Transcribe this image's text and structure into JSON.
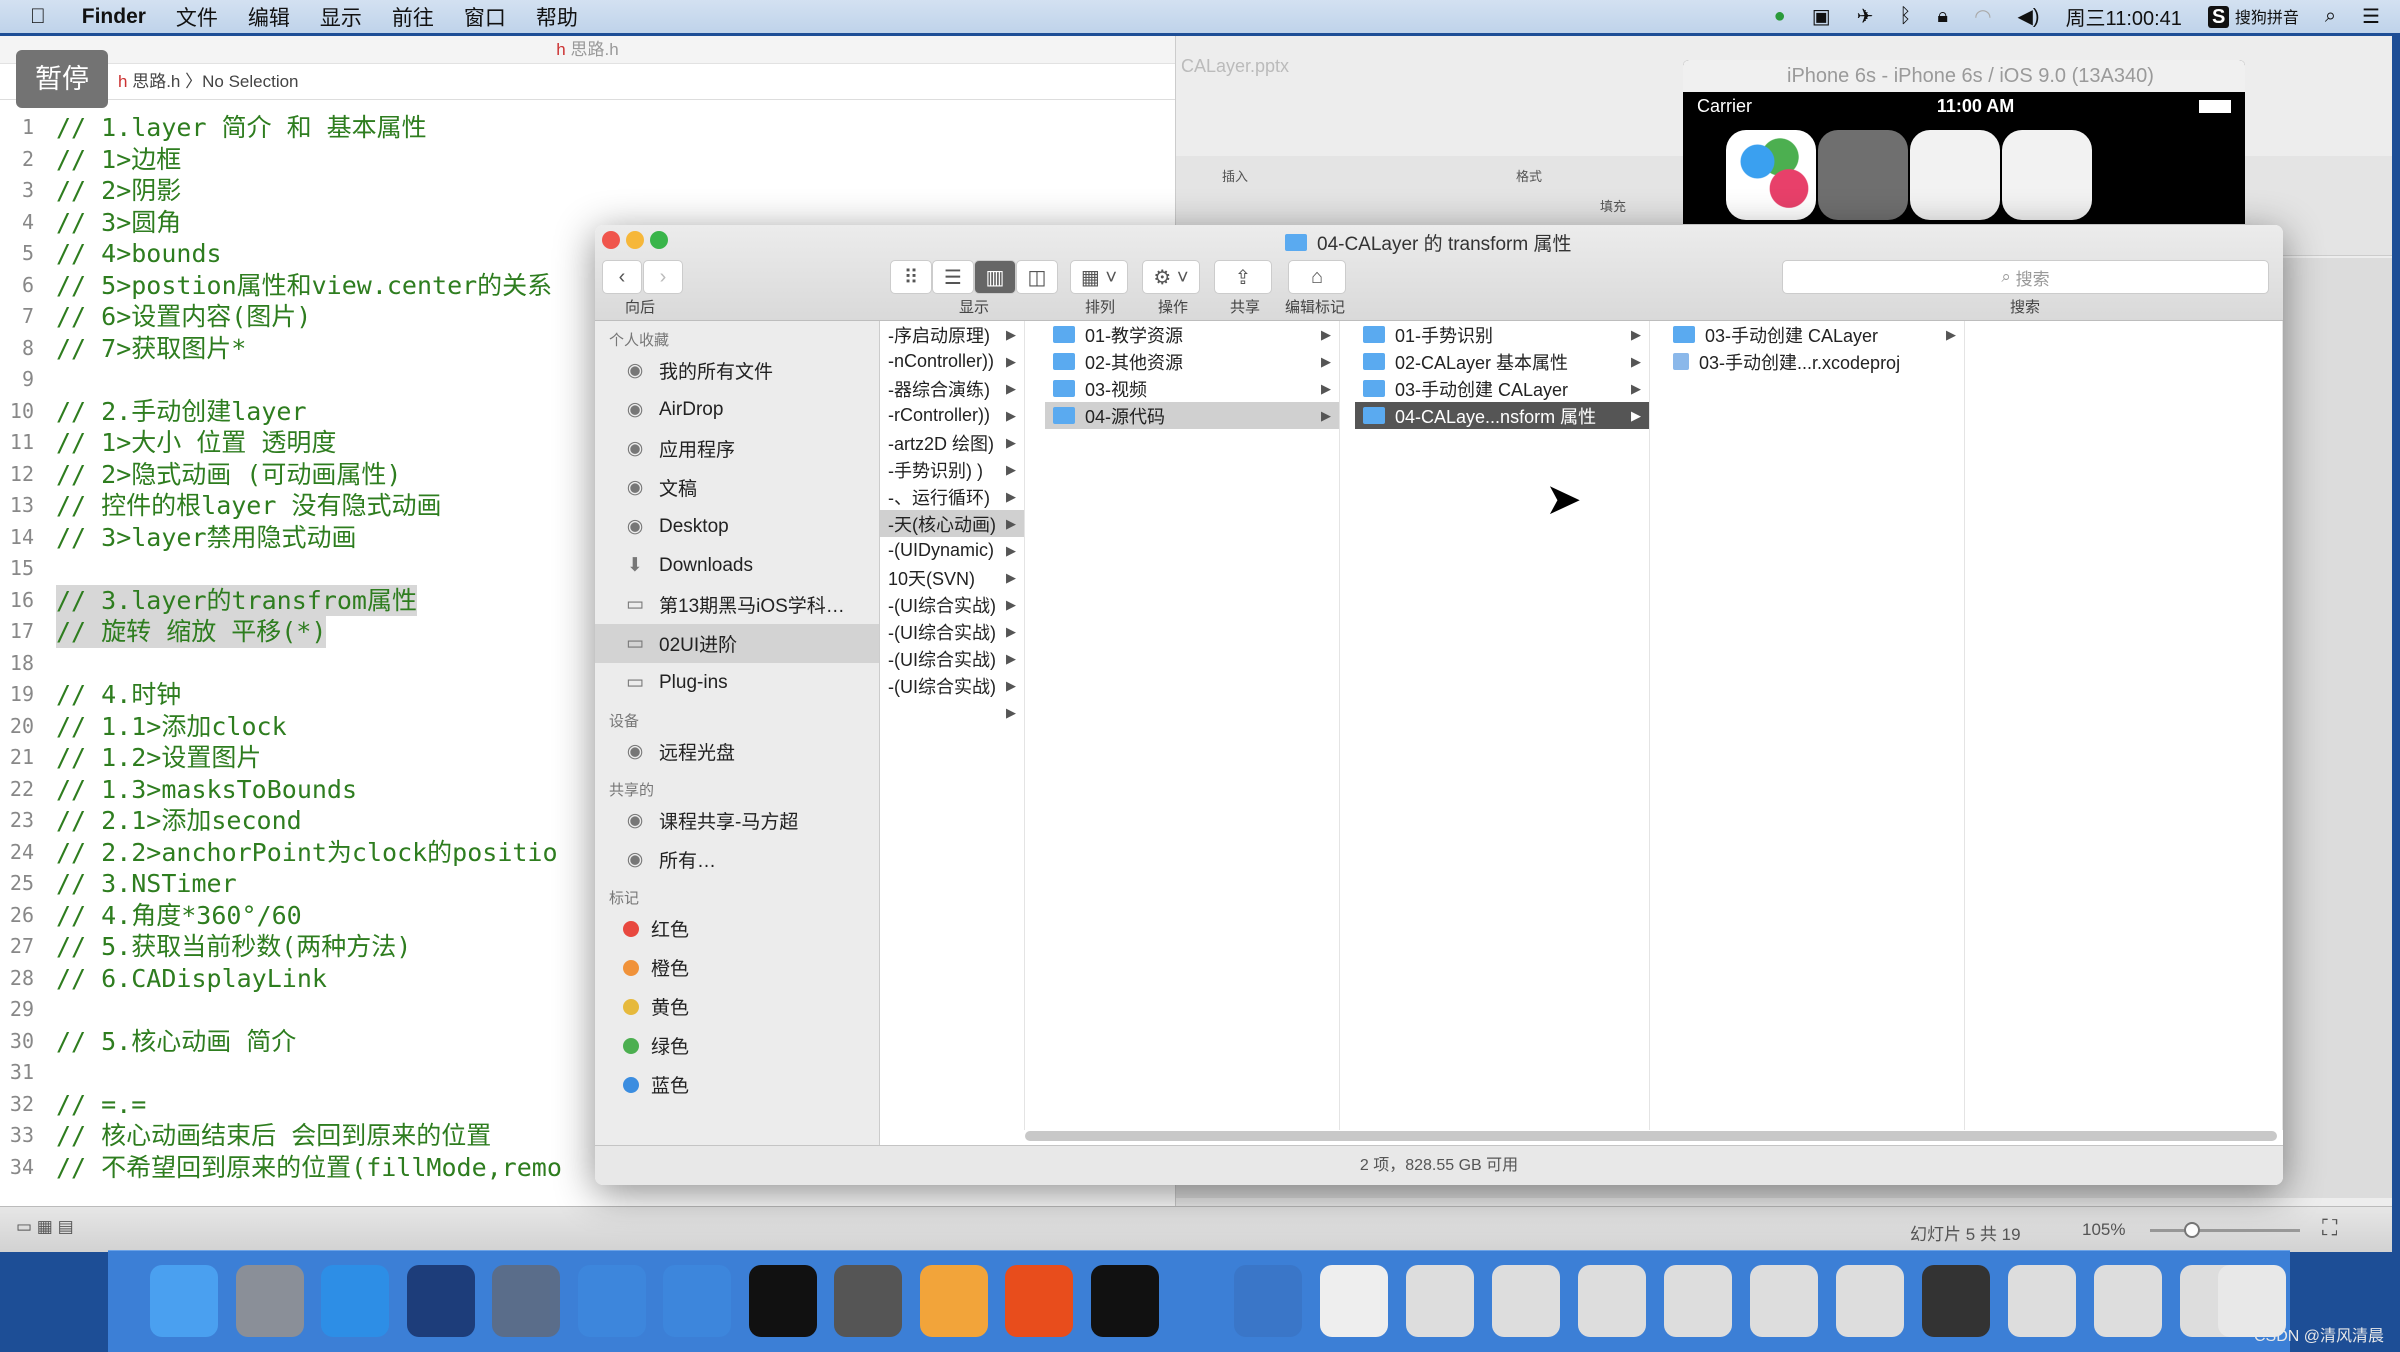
{
  "menubar": {
    "app": "Finder",
    "items": [
      "文件",
      "编辑",
      "显示",
      "前往",
      "窗口",
      "帮助"
    ],
    "clock": "周三11:00:41",
    "ime": "搜狗拼音"
  },
  "xcode": {
    "title": "思路.h",
    "path_file": "思路.h",
    "path_sel": "No Selection",
    "pause": "暂停",
    "lines": [
      "// 1.layer 简介 和 基本属性",
      "// 1>边框",
      "// 2>阴影",
      "// 3>圆角",
      "// 4>bounds",
      "// 5>postion属性和view.center的关系",
      "// 6>设置内容(图片)",
      "// 7>获取图片*",
      "",
      "// 2.手动创建layer",
      "// 1>大小 位置 透明度",
      "// 2>隐式动画 (可动画属性)",
      "// 控件的根layer 没有隐式动画",
      "// 3>layer禁用隐式动画",
      "",
      "// 3.layer的transfrom属性",
      "// 旋转 缩放 平移(*)",
      "",
      "// 4.时钟",
      "// 1.1>添加clock",
      "// 1.2>设置图片",
      "// 1.3>masksToBounds",
      "// 2.1>添加second",
      "// 2.2>anchorPoint为clock的positio",
      "// 3.NSTimer",
      "// 4.角度*360°/60",
      "// 5.获取当前秒数(两种方法)",
      "// 6.CADisplayLink",
      "",
      "// 5.核心动画 简介",
      "",
      "// =.=",
      "// 核心动画结束后 会回到原来的位置",
      "// 不希望回到原来的位置(fillMode,remo"
    ],
    "highlighted_lines": [
      16,
      17
    ]
  },
  "ppt": {
    "title_fragment": "CALayer.pptx",
    "ribbon": [
      "插入",
      "格式",
      "填充"
    ],
    "slide_info": "幻灯片 5 共 19",
    "zoom": "105%"
  },
  "simulator": {
    "title": "iPhone 6s - iPhone 6s / iOS 9.0 (13A340)",
    "carrier": "Carrier",
    "time": "11:00 AM"
  },
  "finder": {
    "title": "04-CALayer 的 transform 属性",
    "toolbar": {
      "back": "向后",
      "view": "显示",
      "arrange": "排列",
      "action": "操作",
      "share": "共享",
      "tags": "编辑标记",
      "search_placeholder": "搜索",
      "search_label": "搜索"
    },
    "sidebar": [
      {
        "header": "个人收藏",
        "items": [
          {
            "label": "我的所有文件",
            "icon": "all-files-icon"
          },
          {
            "label": "AirDrop",
            "icon": "airdrop-icon"
          },
          {
            "label": "应用程序",
            "icon": "applications-icon"
          },
          {
            "label": "文稿",
            "icon": "documents-icon"
          },
          {
            "label": "Desktop",
            "icon": "desktop-icon"
          },
          {
            "label": "Downloads",
            "icon": "downloads-icon"
          },
          {
            "label": "第13期黑马iOS学科…",
            "icon": "folder-icon"
          },
          {
            "label": "02UI进阶",
            "icon": "folder-icon",
            "selected": true
          },
          {
            "label": "Plug-ins",
            "icon": "folder-icon"
          }
        ]
      },
      {
        "header": "设备",
        "items": [
          {
            "label": "远程光盘",
            "icon": "disc-icon"
          }
        ]
      },
      {
        "header": "共享的",
        "items": [
          {
            "label": "课程共享-马方超",
            "icon": "computer-icon"
          },
          {
            "label": "所有…",
            "icon": "network-icon"
          }
        ]
      },
      {
        "header": "标记",
        "items": [
          {
            "label": "红色",
            "color": "#e8483f"
          },
          {
            "label": "橙色",
            "color": "#f0923a"
          },
          {
            "label": "黄色",
            "color": "#e6b93c"
          },
          {
            "label": "绿色",
            "color": "#4caf50"
          },
          {
            "label": "蓝色",
            "color": "#3b8de0"
          }
        ]
      }
    ],
    "columns": [
      {
        "items": [
          {
            "label": "-序启动原理)"
          },
          {
            "label": "-nController))"
          },
          {
            "label": "-器综合演练)"
          },
          {
            "label": "-rController))"
          },
          {
            "label": "-artz2D 绘图)"
          },
          {
            "label": "-手势识别) )"
          },
          {
            "label": "-、运行循环)"
          },
          {
            "label": "-天(核心动画)",
            "selected": true
          },
          {
            "label": "-(UIDynamic)"
          },
          {
            "label": "10天(SVN)"
          },
          {
            "label": "-(UI综合实战)"
          },
          {
            "label": "-(UI综合实战)"
          },
          {
            "label": "-(UI综合实战)"
          },
          {
            "label": "-(UI综合实战)"
          },
          {
            "label": ""
          }
        ]
      },
      {
        "items": [
          {
            "label": "01-教学资源",
            "folder": true
          },
          {
            "label": "02-其他资源",
            "folder": true
          },
          {
            "label": "03-视频",
            "folder": true
          },
          {
            "label": "04-源代码",
            "folder": true,
            "selected": true
          }
        ]
      },
      {
        "items": [
          {
            "label": "01-手势识别",
            "folder": true
          },
          {
            "label": "02-CALayer 基本属性",
            "folder": true
          },
          {
            "label": "03-手动创建 CALayer",
            "folder": true
          },
          {
            "label": "04-CALaye...nsform 属性",
            "folder": true,
            "selected": true,
            "active": true
          }
        ]
      },
      {
        "items": [
          {
            "label": "03-手动创建 CALayer",
            "folder": true
          },
          {
            "label": "03-手动创建...r.xcodeproj",
            "file": true,
            "noarrow": true
          }
        ]
      },
      {
        "items": []
      }
    ],
    "status": "2 项，828.55 GB 可用"
  },
  "dock": {
    "apps": [
      "finder",
      "launchpad",
      "safari",
      "mouse",
      "imovie",
      "xcode",
      "instruments",
      "terminal",
      "system-preferences",
      "sketch",
      "wps-presentation",
      "console",
      "quicktime",
      "preview",
      "screenshot-1",
      "screenshot-2",
      "screenshot-3",
      "screenshot-4",
      "screenshot-5",
      "screenshot-6",
      "screenshot-7",
      "screenshot-8",
      "screenshot-9",
      "screenshot-10",
      "trash"
    ]
  },
  "watermark": "CSDN @清风清晨"
}
